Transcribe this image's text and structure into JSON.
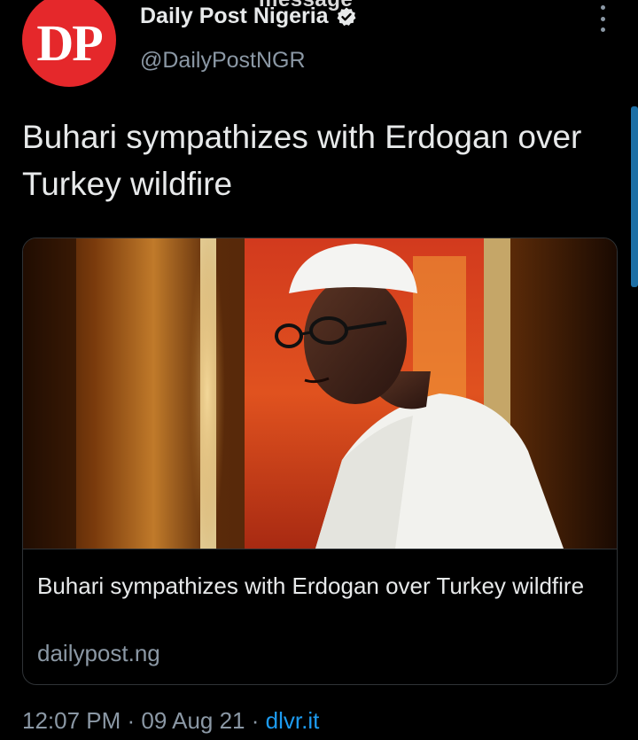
{
  "header": {
    "fragment_text": "message",
    "avatar_text": "DP",
    "display_name": "Daily Post Nigeria",
    "handle": "@DailyPostNGR",
    "verified_icon": "verified-badge-icon",
    "more_icon": "more-vertical-icon"
  },
  "tweet": {
    "text": "Buhari sympathizes with Erdogan over Turkey wildfire"
  },
  "card": {
    "title": "Buhari sympathizes with Erdogan over Turkey wildfire",
    "domain": "dailypost.ng"
  },
  "meta": {
    "time": "12:07 PM",
    "separator1": " · ",
    "date": "09 Aug 21",
    "separator2": " · ",
    "source": "dlvr.it"
  },
  "colors": {
    "background": "#000000",
    "primary_text": "#e7e9ea",
    "secondary_text": "#8b98a5",
    "link": "#1d9bf0",
    "avatar_bg": "#e5282b",
    "border": "#2f3336"
  }
}
